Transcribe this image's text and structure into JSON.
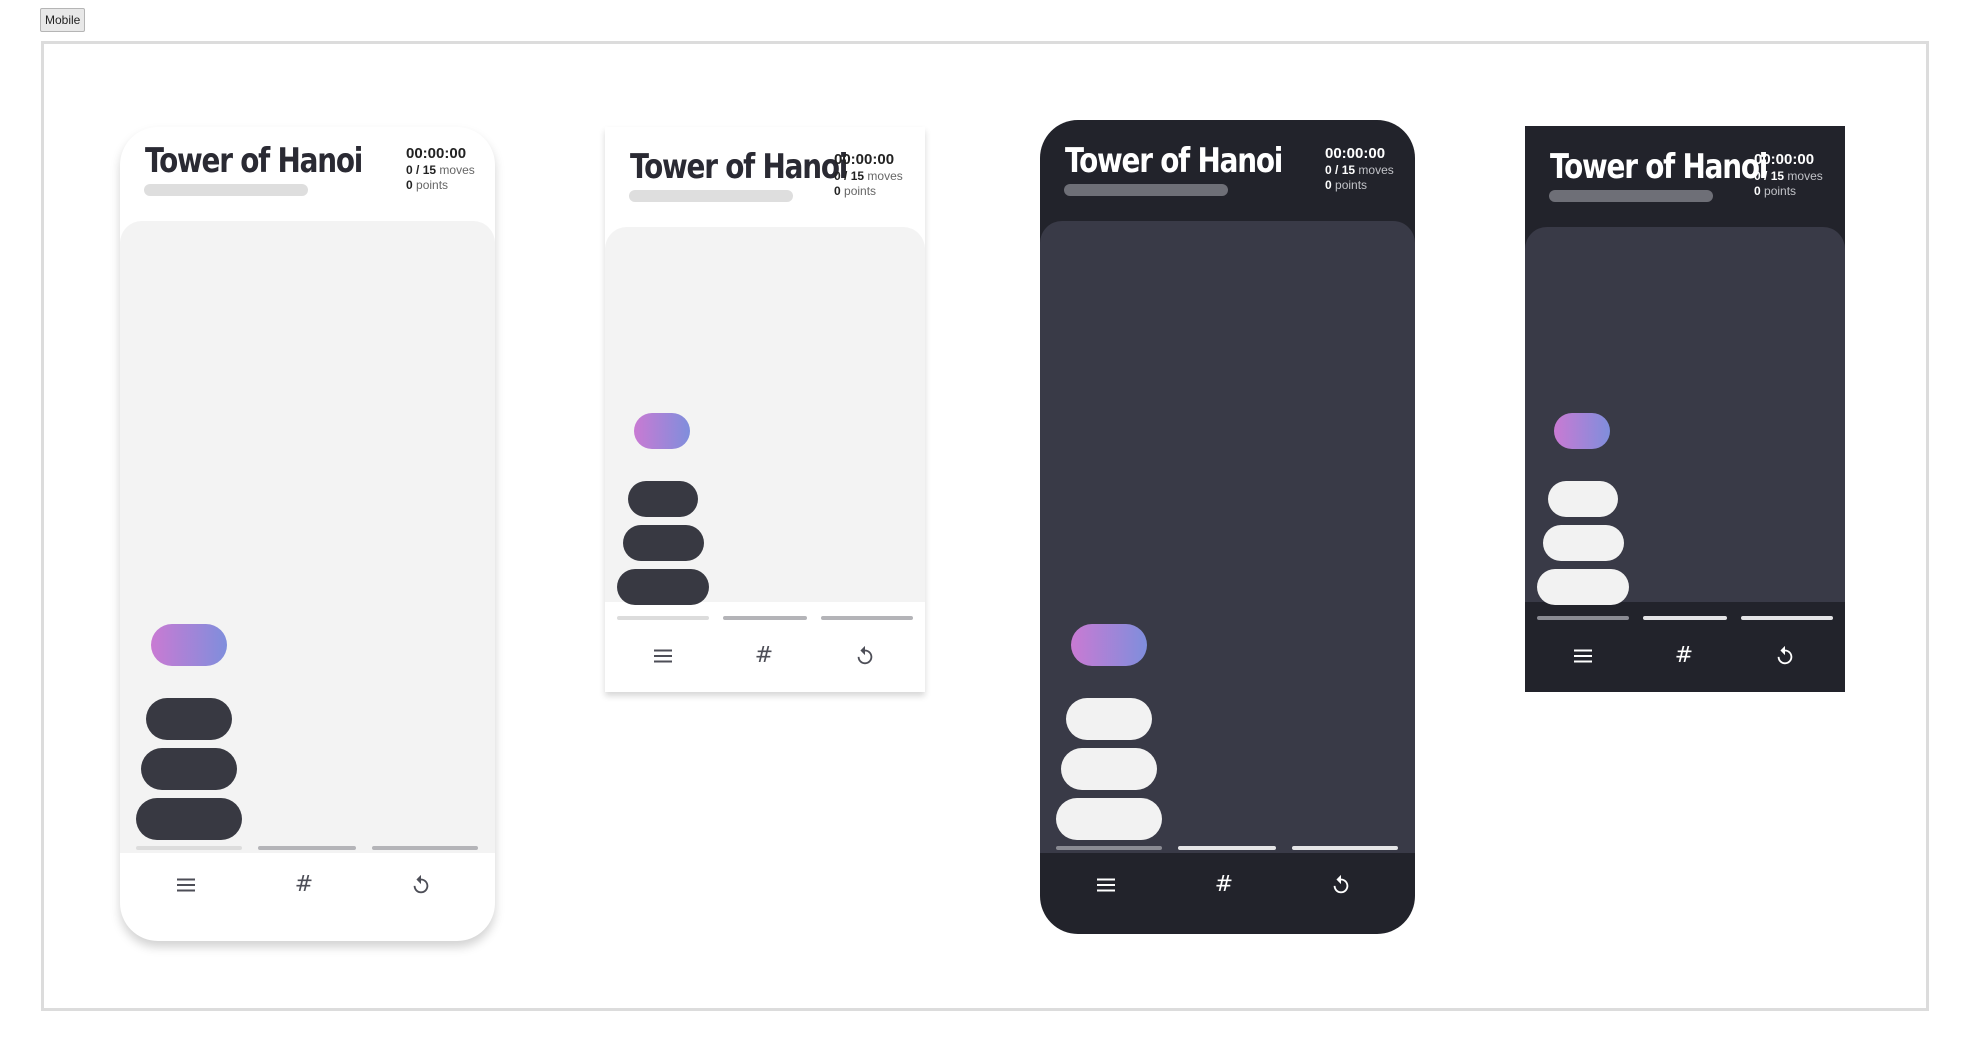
{
  "toolbar": {
    "mode_button": "Mobile"
  },
  "game": {
    "title": "Tower of Hanoi",
    "timer": "00:00:00",
    "moves_current": "0",
    "moves_total": "15",
    "moves_unit": "moves",
    "points_value": "0",
    "points_unit": "points",
    "selected_disk_color_start": "#c97ad3",
    "selected_disk_color_end": "#7f8edc"
  },
  "variants": [
    {
      "theme": "light",
      "frame": "rounded"
    },
    {
      "theme": "light",
      "frame": "square"
    },
    {
      "theme": "dark",
      "frame": "rounded"
    },
    {
      "theme": "dark",
      "frame": "square"
    }
  ],
  "nav": [
    {
      "icon": "menu-icon"
    },
    {
      "icon": "hash-icon",
      "glyph": "#"
    },
    {
      "icon": "restart-icon"
    }
  ],
  "colors": {
    "light_board": "#f3f3f3",
    "dark_background": "#22232b",
    "dark_board": "#393a47"
  }
}
